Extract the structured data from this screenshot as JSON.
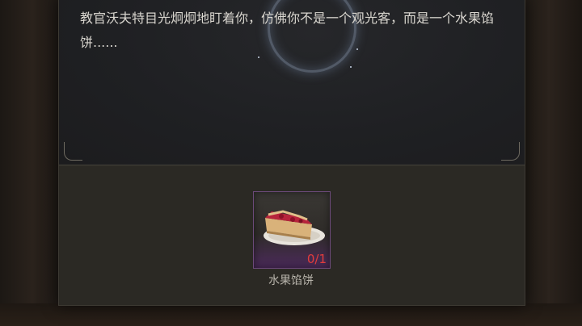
{
  "dialog": {
    "text": "教官沃夫特目光炯炯地盯着你，仿佛你不是一个观光客，而是一个水果馅饼......"
  },
  "item": {
    "name": "水果馅饼",
    "count": "0/1",
    "icon": "fruit-pie-icon"
  },
  "colors": {
    "count": "#e23c3c",
    "slot_border": "#6c4a7a",
    "text": "#d9d6cf"
  }
}
